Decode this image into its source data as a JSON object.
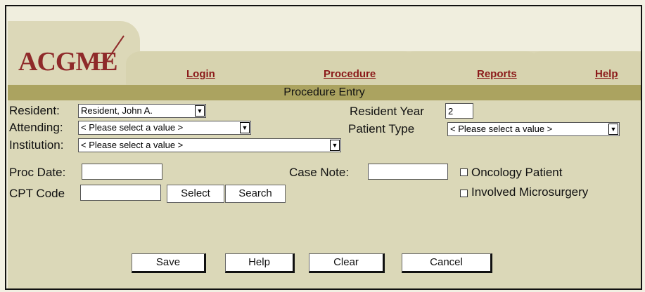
{
  "nav": {
    "logo": "ACGME",
    "login": "Login",
    "procedure": "Procedure",
    "reports": "Reports",
    "help": "Help"
  },
  "section_title": "Procedure Entry",
  "form": {
    "resident_label": "Resident:",
    "resident_value": "Resident, John A.",
    "resident_year_label": "Resident Year",
    "resident_year_value": "2",
    "attending_label": "Attending:",
    "attending_value": "< Please select a value >",
    "patient_type_label": "Patient Type",
    "patient_type_value": "< Please select a value >",
    "institution_label": "Institution:",
    "institution_value": "< Please select a value >",
    "proc_date_label": "Proc Date:",
    "case_note_label": "Case Note:",
    "cpt_code_label": "CPT Code",
    "select_label": "Select",
    "search_label": "Search",
    "oncology_label": "Oncology Patient",
    "microsurgery_label": "Involved Microsurgery"
  },
  "actions": {
    "save": "Save",
    "help": "Help",
    "clear": "Clear",
    "cancel": "Cancel"
  },
  "colors": {
    "title_bar": "#aba360",
    "content_bg": "#dbd8b8",
    "link": "#8b1a1a"
  }
}
